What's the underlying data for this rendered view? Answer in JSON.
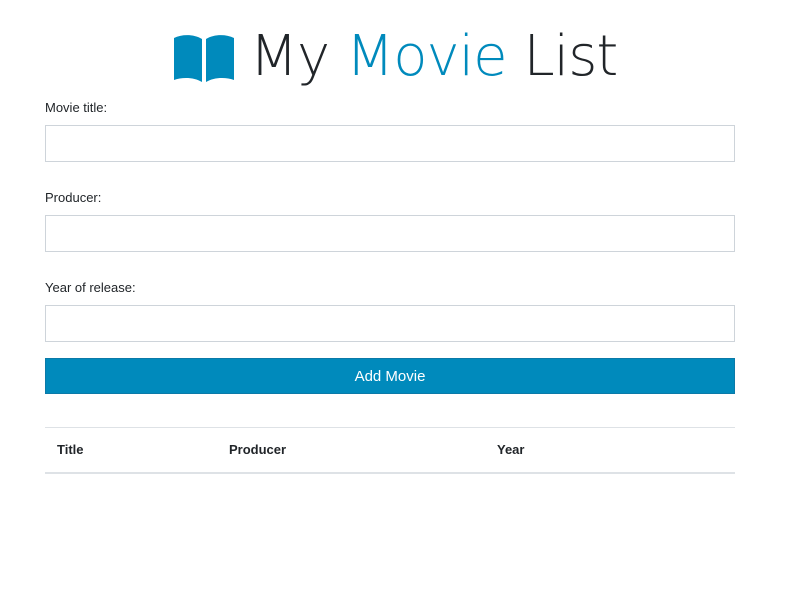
{
  "header": {
    "logo_icon": "open-book-icon",
    "title_part1": "My ",
    "title_part2": "Movie",
    "title_part3": " List",
    "accent_color": "#008abc"
  },
  "form": {
    "movie_title_label": "Movie title:",
    "movie_title_value": "",
    "producer_label": "Producer:",
    "producer_value": "",
    "year_label": "Year of release:",
    "year_value": "",
    "submit_label": "Add Movie"
  },
  "table": {
    "columns": [
      "Title",
      "Producer",
      "Year"
    ],
    "rows": []
  }
}
